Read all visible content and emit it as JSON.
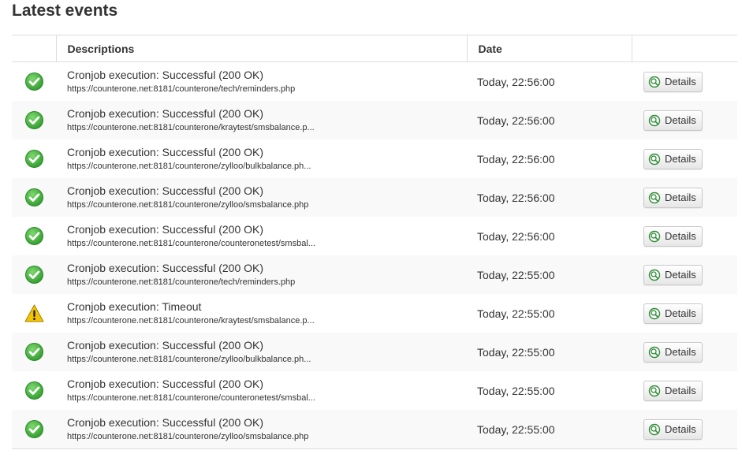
{
  "page": {
    "title": "Latest events"
  },
  "table": {
    "headers": {
      "status": "",
      "descriptions": "Descriptions",
      "date": "Date",
      "actions": ""
    },
    "rows": [
      {
        "status": "success-icon",
        "title": "Cronjob execution: Successful (200 OK)",
        "url": "https://counterone.net:8181/counterone/tech/reminders.php",
        "date": "Today, 22:56:00",
        "action": "Details"
      },
      {
        "status": "success-icon",
        "title": "Cronjob execution: Successful (200 OK)",
        "url": "https://counterone.net:8181/counterone/kraytest/smsbalance.p...",
        "date": "Today, 22:56:00",
        "action": "Details"
      },
      {
        "status": "success-icon",
        "title": "Cronjob execution: Successful (200 OK)",
        "url": "https://counterone.net:8181/counterone/zylloo/bulkbalance.ph...",
        "date": "Today, 22:56:00",
        "action": "Details"
      },
      {
        "status": "success-icon",
        "title": "Cronjob execution: Successful (200 OK)",
        "url": "https://counterone.net:8181/counterone/zylloo/smsbalance.php",
        "date": "Today, 22:56:00",
        "action": "Details"
      },
      {
        "status": "success-icon",
        "title": "Cronjob execution: Successful (200 OK)",
        "url": "https://counterone.net:8181/counterone/counteronetest/smsbal...",
        "date": "Today, 22:56:00",
        "action": "Details"
      },
      {
        "status": "success-icon",
        "title": "Cronjob execution: Successful (200 OK)",
        "url": "https://counterone.net:8181/counterone/tech/reminders.php",
        "date": "Today, 22:55:00",
        "action": "Details"
      },
      {
        "status": "warning-icon",
        "title": "Cronjob execution: Timeout",
        "url": "https://counterone.net:8181/counterone/kraytest/smsbalance.p...",
        "date": "Today, 22:55:00",
        "action": "Details"
      },
      {
        "status": "success-icon",
        "title": "Cronjob execution: Successful (200 OK)",
        "url": "https://counterone.net:8181/counterone/zylloo/bulkbalance.ph...",
        "date": "Today, 22:55:00",
        "action": "Details"
      },
      {
        "status": "success-icon",
        "title": "Cronjob execution: Successful (200 OK)",
        "url": "https://counterone.net:8181/counterone/counteronetest/smsbal...",
        "date": "Today, 22:55:00",
        "action": "Details"
      },
      {
        "status": "success-icon",
        "title": "Cronjob execution: Successful (200 OK)",
        "url": "https://counterone.net:8181/counterone/zylloo/smsbalance.php",
        "date": "Today, 22:55:00",
        "action": "Details"
      }
    ]
  },
  "colors": {
    "success": "#3aaa35",
    "warning": "#f5c400",
    "row_alt": "#f9f9f9",
    "border": "#dddddd"
  }
}
